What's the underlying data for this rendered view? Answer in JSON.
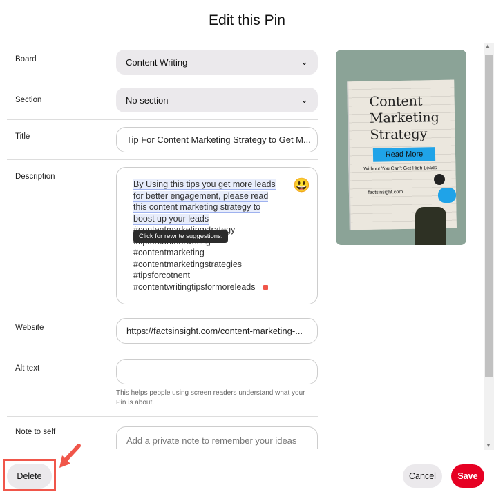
{
  "title": "Edit this Pin",
  "fields": {
    "board": {
      "label": "Board",
      "value": "Content Writing"
    },
    "section": {
      "label": "Section",
      "value": "No section"
    },
    "title": {
      "label": "Title",
      "value": "Tip For Content Marketing Strategy to Get M..."
    },
    "description": {
      "label": "Description",
      "lines_highlighted": [
        "By Using this tips you get more leads",
        "for better engagement, please read",
        "this content marketing strategy to",
        "boost up your leads"
      ],
      "lines": [
        "#contentmarketingstrategy",
        "#tipforcontentwriting",
        "#contentmarketing",
        "#contentmarketingstrategies",
        "#tipsforcotnent",
        "#contentwritingtipsformoreleads"
      ],
      "tooltip": "Click for rewrite suggestions.",
      "emoji": "😃"
    },
    "website": {
      "label": "Website",
      "value": "https://factsinsight.com/content-marketing-..."
    },
    "alt_text": {
      "label": "Alt text",
      "value": "",
      "helper": "This helps people using screen readers understand what your Pin is about."
    },
    "note": {
      "label": "Note to self",
      "placeholder": "Add a private note to remember your ideas about this Pin"
    }
  },
  "pin_image": {
    "heading": [
      "Content",
      "Marketing",
      "Strategy"
    ],
    "button": "Read More",
    "tagline": "Without You Can't Get High Leads",
    "site": "factsinsight.com",
    "bg": "#8ba397"
  },
  "footer": {
    "delete": "Delete",
    "cancel": "Cancel",
    "save": "Save",
    "save_color": "#e60023",
    "annotation_color": "#f0564a"
  }
}
